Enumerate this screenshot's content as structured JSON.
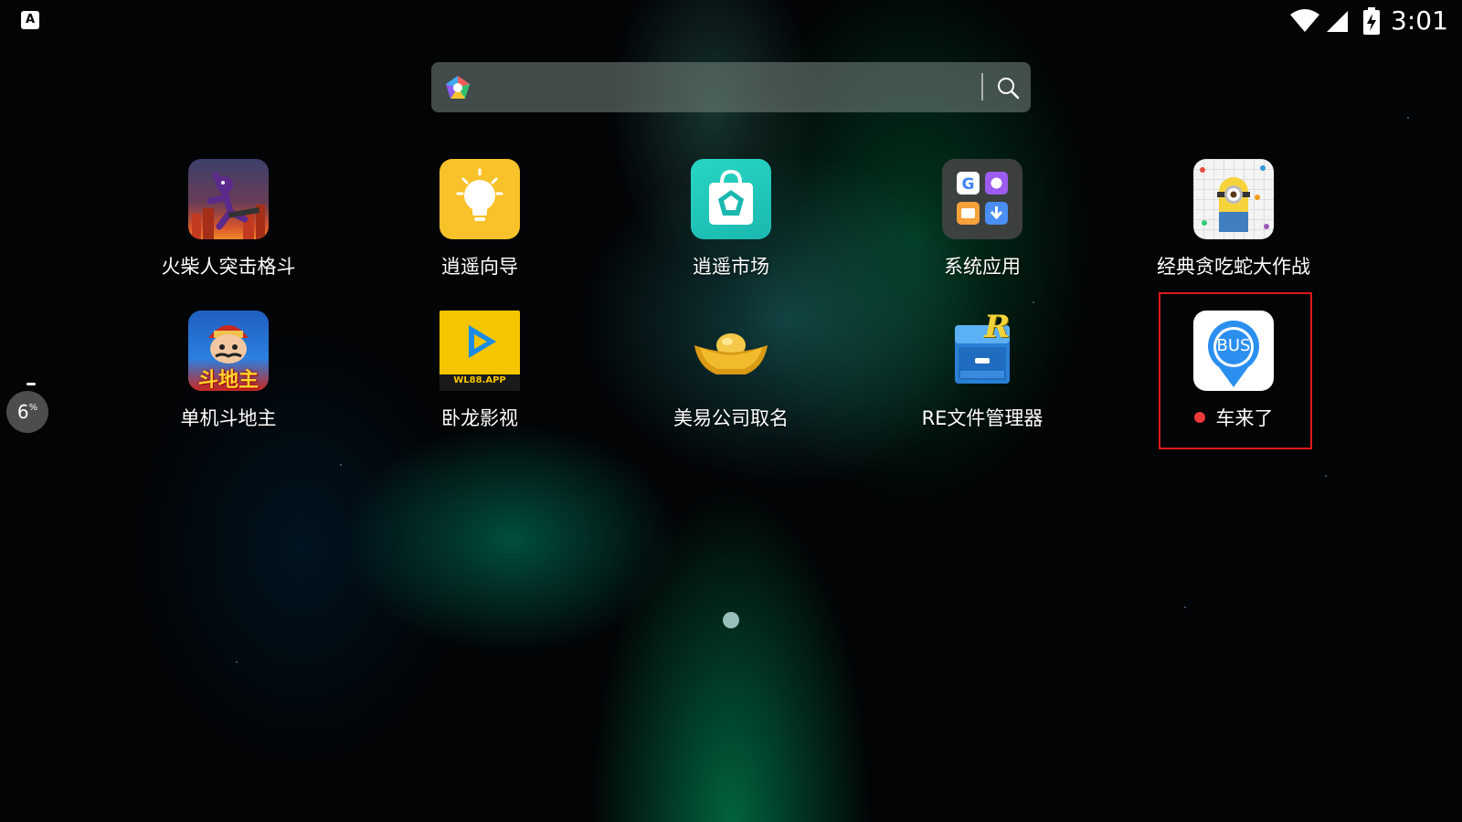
{
  "status_bar": {
    "notification_icon": "A",
    "icons": [
      "wifi-icon",
      "signal-icon",
      "battery-charging-icon"
    ],
    "time": "3:01"
  },
  "search_bar": {
    "logo_icon": "browser-logo-icon",
    "search_icon": "search-icon"
  },
  "apps": [
    {
      "label": "火柴人突击格斗",
      "icon": "stickman-fighter-icon"
    },
    {
      "label": "逍遥向导",
      "icon": "lightbulb-icon"
    },
    {
      "label": "逍遥市场",
      "icon": "market-bag-icon"
    },
    {
      "label": "系统应用",
      "icon": "system-apps-folder-icon"
    },
    {
      "label": "经典贪吃蛇大作战",
      "icon": "snake-game-icon"
    },
    {
      "label": "单机斗地主",
      "icon": "doudizhu-icon",
      "icon_text": "斗地主"
    },
    {
      "label": "卧龙影视",
      "icon": "video-play-icon",
      "icon_text": "WL88.APP"
    },
    {
      "label": "美易公司取名",
      "icon": "gold-ingot-icon"
    },
    {
      "label": "RE文件管理器",
      "icon": "file-manager-icon",
      "icon_text": "R"
    },
    {
      "label": "车来了",
      "icon": "bus-pin-icon",
      "icon_text": "BUS",
      "new_badge": true
    }
  ],
  "floating_widget": {
    "value": "6",
    "unit": "%"
  },
  "page_indicator": {
    "pages": 1,
    "current": 1
  },
  "colors": {
    "highlight": "#e01818",
    "badge": "#f03a3a"
  }
}
